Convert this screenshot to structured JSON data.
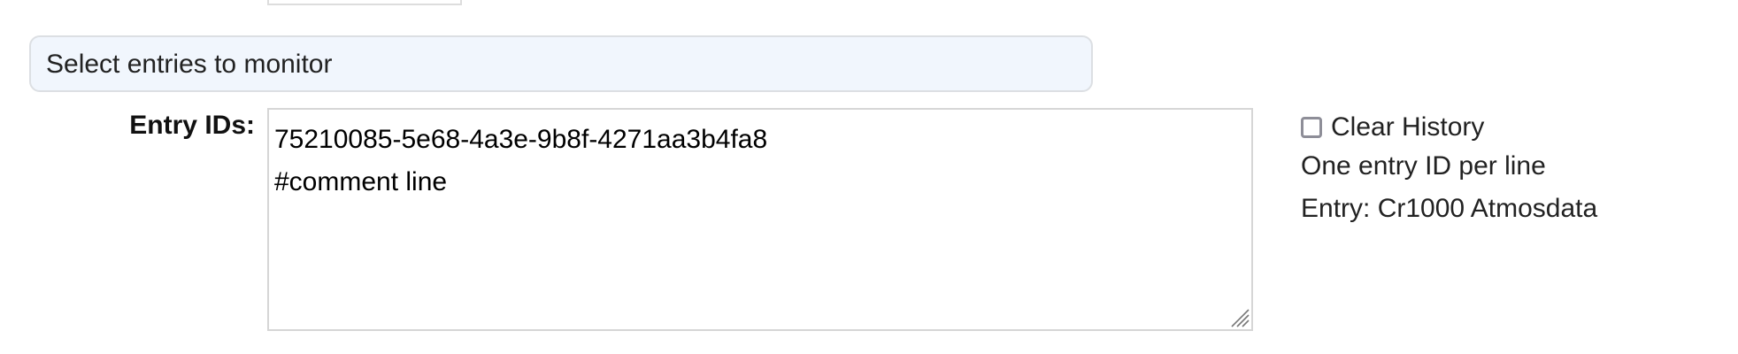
{
  "section": {
    "title": "Select entries to monitor"
  },
  "form": {
    "entry_ids_label": "Entry IDs:",
    "entry_ids_lines": [
      "75210085-5e68-4a3e-9b8f-4271aa3b4fa8",
      "#comment line"
    ],
    "clear_history_label": "Clear History",
    "clear_history_checked": false,
    "help_text": "One entry ID per line",
    "entry_info": "Entry: Cr1000 Atmosdata"
  }
}
